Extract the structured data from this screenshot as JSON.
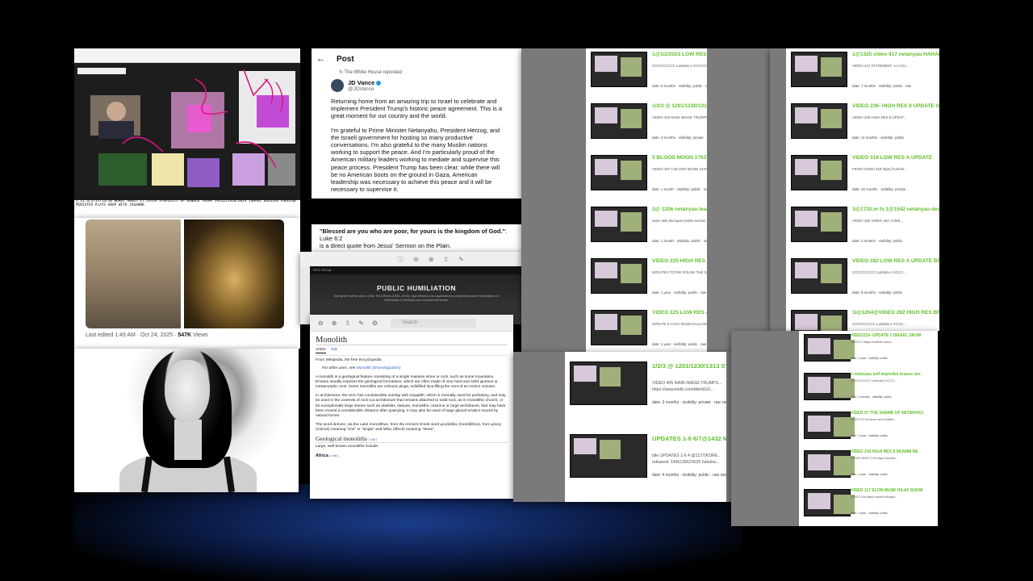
{
  "win1": {
    "caption": "VIDEO 214 HIGH RES 8 · UPDATE 11/14/15/16 trump trumpi 1618 12420/22/2024 6/8/7/6/01 7/9@121/425/24/2024 1 11 3/5/15/13/10 WORRY ABOUT IT LATER STUPIDITY OF DONALD TRUMP 1931221920/2024 ISRAEL SOLDIER FOREIGN MINISTER PLAYS SNAP WITH JASHANK"
  },
  "post": {
    "header": "Post",
    "reposted": "The White House reposted",
    "name": "JD Vance",
    "handle": "@JDVance",
    "p1": "Returning home from an amazing trip to Israel to celebrate and implement President Trump's historic peace agreement. This is a great moment for our country and the world.",
    "p2": "I'm grateful to Prime Minister Netanyahu, President Herzog, and the Israeli government for hosting so many productive conversations. I'm also grateful to the many Muslim nations working to support the peace. And I'm particularly proud of the American military leaders working to mediate and supervise this peace process. President Trump has been clear: while there will be no American boots on the ground in Gaza, American leadership was necessary to achieve this peace and it will be necessary to supervise it."
  },
  "photos": {
    "last_edited": "Last edited 1:49 AM · Oct 24, 2025 · ",
    "views_count": "547K",
    "views_label": " Views"
  },
  "bible": {
    "quote": "\"Blessed are you who are poor, for yours is the kingdom of God.\"",
    "tail": ": Luke 6:2",
    "line2": "is a direct quote from Jesus' Sermon on the Plain."
  },
  "encyclopedia": {
    "brand": "EPIC PEDIA",
    "heading": "PUBLIC HUMILIATION",
    "sub": "During the twelve years of the Third Reich (1933–1945), Nazi officials and organizations perpetrated public humiliations of individuals in Germany and occupied territories."
  },
  "wiki": {
    "search": "Search",
    "title": "Monolith",
    "tab_article": "Article",
    "tab_talk": "Talk",
    "from": "From Wikipedia, the free encyclopedia",
    "hatnote_pre": "For other uses, see ",
    "hatnote_link": "Monolith (disambiguation)",
    "p1": "A monolith is a geological feature consisting of a single massive stone or rock, such as some mountains. Erosion usually exposes the geological formations, which are often made of very hard and solid igneous or metamorphic rock. Some monoliths are volcanic plugs, solidified lava filling the vent of an extinct volcano.",
    "p2": "In architecture, the term has considerable overlap with megalith, which is normally used for prehistory, and may be used in the contexts of rock-cut architecture that remains attached to solid rock, as in monolithic church, or for exceptionally large stones such as obelisks, statues, monolithic columns or large architraves, that may have been moved a considerable distance after quarrying. It may also be used of large glacial erratics moved by natural forces.",
    "p3": "The word derives, via the Latin monolithus, from the Ancient Greek word μονόλιθος (monólithos), from μόνος (mónos) meaning \"one\" or \"single\" and λίθος (líthos) meaning \"stone\".",
    "h2": "Geological monoliths",
    "edit": "[ edit ]",
    "p4": "Large, well-known monoliths include:",
    "h3": "Africa"
  },
  "list8": [
    {
      "title": "1@1/2/2023 LOW RES 282 SPORTS HAHAHAHAHAHAHA",
      "desc": "COCCCCCCC Lambda A VCCCCC...",
      "stats": "date: 8 months · visibility: public · raw views"
    },
    {
      "title": "1/2/3 @ 1201/1230/1313 STRONG -MORE VOMIT FROM MOTHER FKER IS STRONG",
      "desc": "VIDEO 405 MAIN IMAGE TRUMPS...",
      "stats": "date: 3 months · visibility: private · raw views"
    },
    {
      "title": "5 BLOOD MOON 17637 4 ALL SNORTER OF TRUMP -tuxwop",
      "desc": "VIDEO 487 5 BLOOD MOON 16371...",
      "stats": "date: 1 month · visibility: public · raw views"
    },
    {
      "title": "2@ 1206 netanyau leader kkk00perer video 485 are",
      "desc": "video 486 decoupin yvette woman...",
      "stats": "date: 1 month · visibility: public · raw views"
    },
    {
      "title": "VIDEO 225 HIGH RES 8 UPDATE SKUM AGAIN YOAV GALLANT",
      "desc": "UPDATES TOTHE POLISE THE SK...",
      "stats": "date: 1 year · visibility: public · raw views"
    },
    {
      "title": "VIDEO 225 LOW RES A UPDATE AGAIN YOAV GALLANT KKK",
      "desc": "UPDATE 8 YOAV SKUM GALLANT...",
      "stats": "date: 1 year · visibility: public · raw views"
    }
  ],
  "list9": [
    {
      "title": "1@1325 video 417 netanyau HAHAHAHAHAHA",
      "desc": "VIDEO 417 STATEMENT -U CAN...",
      "stats": "date: 7 months · visibility: public · raw"
    },
    {
      "title": "VIDEO 236- HIGH RES 8 UPDATE GOOD THINGS -TUOWS",
      "desc": "VIDEO 236 HIGH RES 8 UPDAT...",
      "stats": "date: 11 months · visibility: public"
    },
    {
      "title": "VIDEO 319 LOW RES A UPDATE",
      "desc": "FROM VIDEO 318 https://rumble...",
      "stats": "date: 10 months · visibility: private"
    },
    {
      "title": "3@1720.m fx 1@1542 netanyau destroyerer released 1",
      "desc": "VIDEO 482 VIDEO 482 1746E...",
      "stats": "date: 2 months · visibility: public"
    },
    {
      "title": "VIDEO 282 LOW RES A UPDATE BRACCE; -IKWIZZK IMENARE",
      "desc": "COCCCCCCC Lambda A VCCC...",
      "stats": "date: 8 months · visibility: public"
    },
    {
      "title": "1I@1204@VIDEO 282 HIGH RES BRACCE; -IKWIZZK IMENAR",
      "desc": "COCCCCCCC Lambda A VCCC...",
      "stats": "date: 8 months · visibility: public"
    }
  ],
  "list10": [
    {
      "title": "1/2/3 @ 1201/1230/1313 STRONG -MORE VOMIT FROM",
      "desc": "VIDEO 405 MAIN IMAGE TRUMPS...",
      "desc2": "https://www.imdb.com/title/tt161...",
      "stats": "date: 3 months · visibility: private · raw views"
    },
    {
      "title": "UPDATES 1-6 6/7@1432 MRS WAG DULLINS @ 16",
      "desc": "title UPDATES 1-6 4 @1127(KORE...",
      "desc2": "released: 1456130623025 hahaha...",
      "stats": "date: 4 months · visibility: public · raw views"
    }
  ],
  "list11": [
    {
      "title": "VIDEO219- UPDATE 1 ISRAEL SKUM",
      "desc": "VIDEO 2 https://rumble.com/v...",
      "stats": "date: 1 year · visibility: public"
    },
    {
      "title": "1 netanyau self implodes brasse sex",
      "desc": "COCCCCCCC Lambda A VCCC...",
      "stats": "date: 2 months · visibility: public"
    },
    {
      "title": "VIDEO 57 THE SHAME OF NETANYAU",
      "desc": "VIDEO 57 sit down and breathe...",
      "stats": "date: 1 year · visibility: public"
    },
    {
      "title": "VIDEO 219 HIGH RES 8 SKAMM RE",
      "desc": "FROM VIDEO 219 https://rumble...",
      "stats": "date: 1 year · visibility: public"
    },
    {
      "title": "VIDEO 117 ELON MUSK HILAF SHOW",
      "desc": "VIDEO 118 https://www.nobodyli...",
      "stats": "date: 1 year · visibility: public"
    }
  ],
  "colors": {
    "green_title": "#5fbf2a",
    "x_blue": "#1d9bf0",
    "wiki_link": "#3366cc"
  }
}
